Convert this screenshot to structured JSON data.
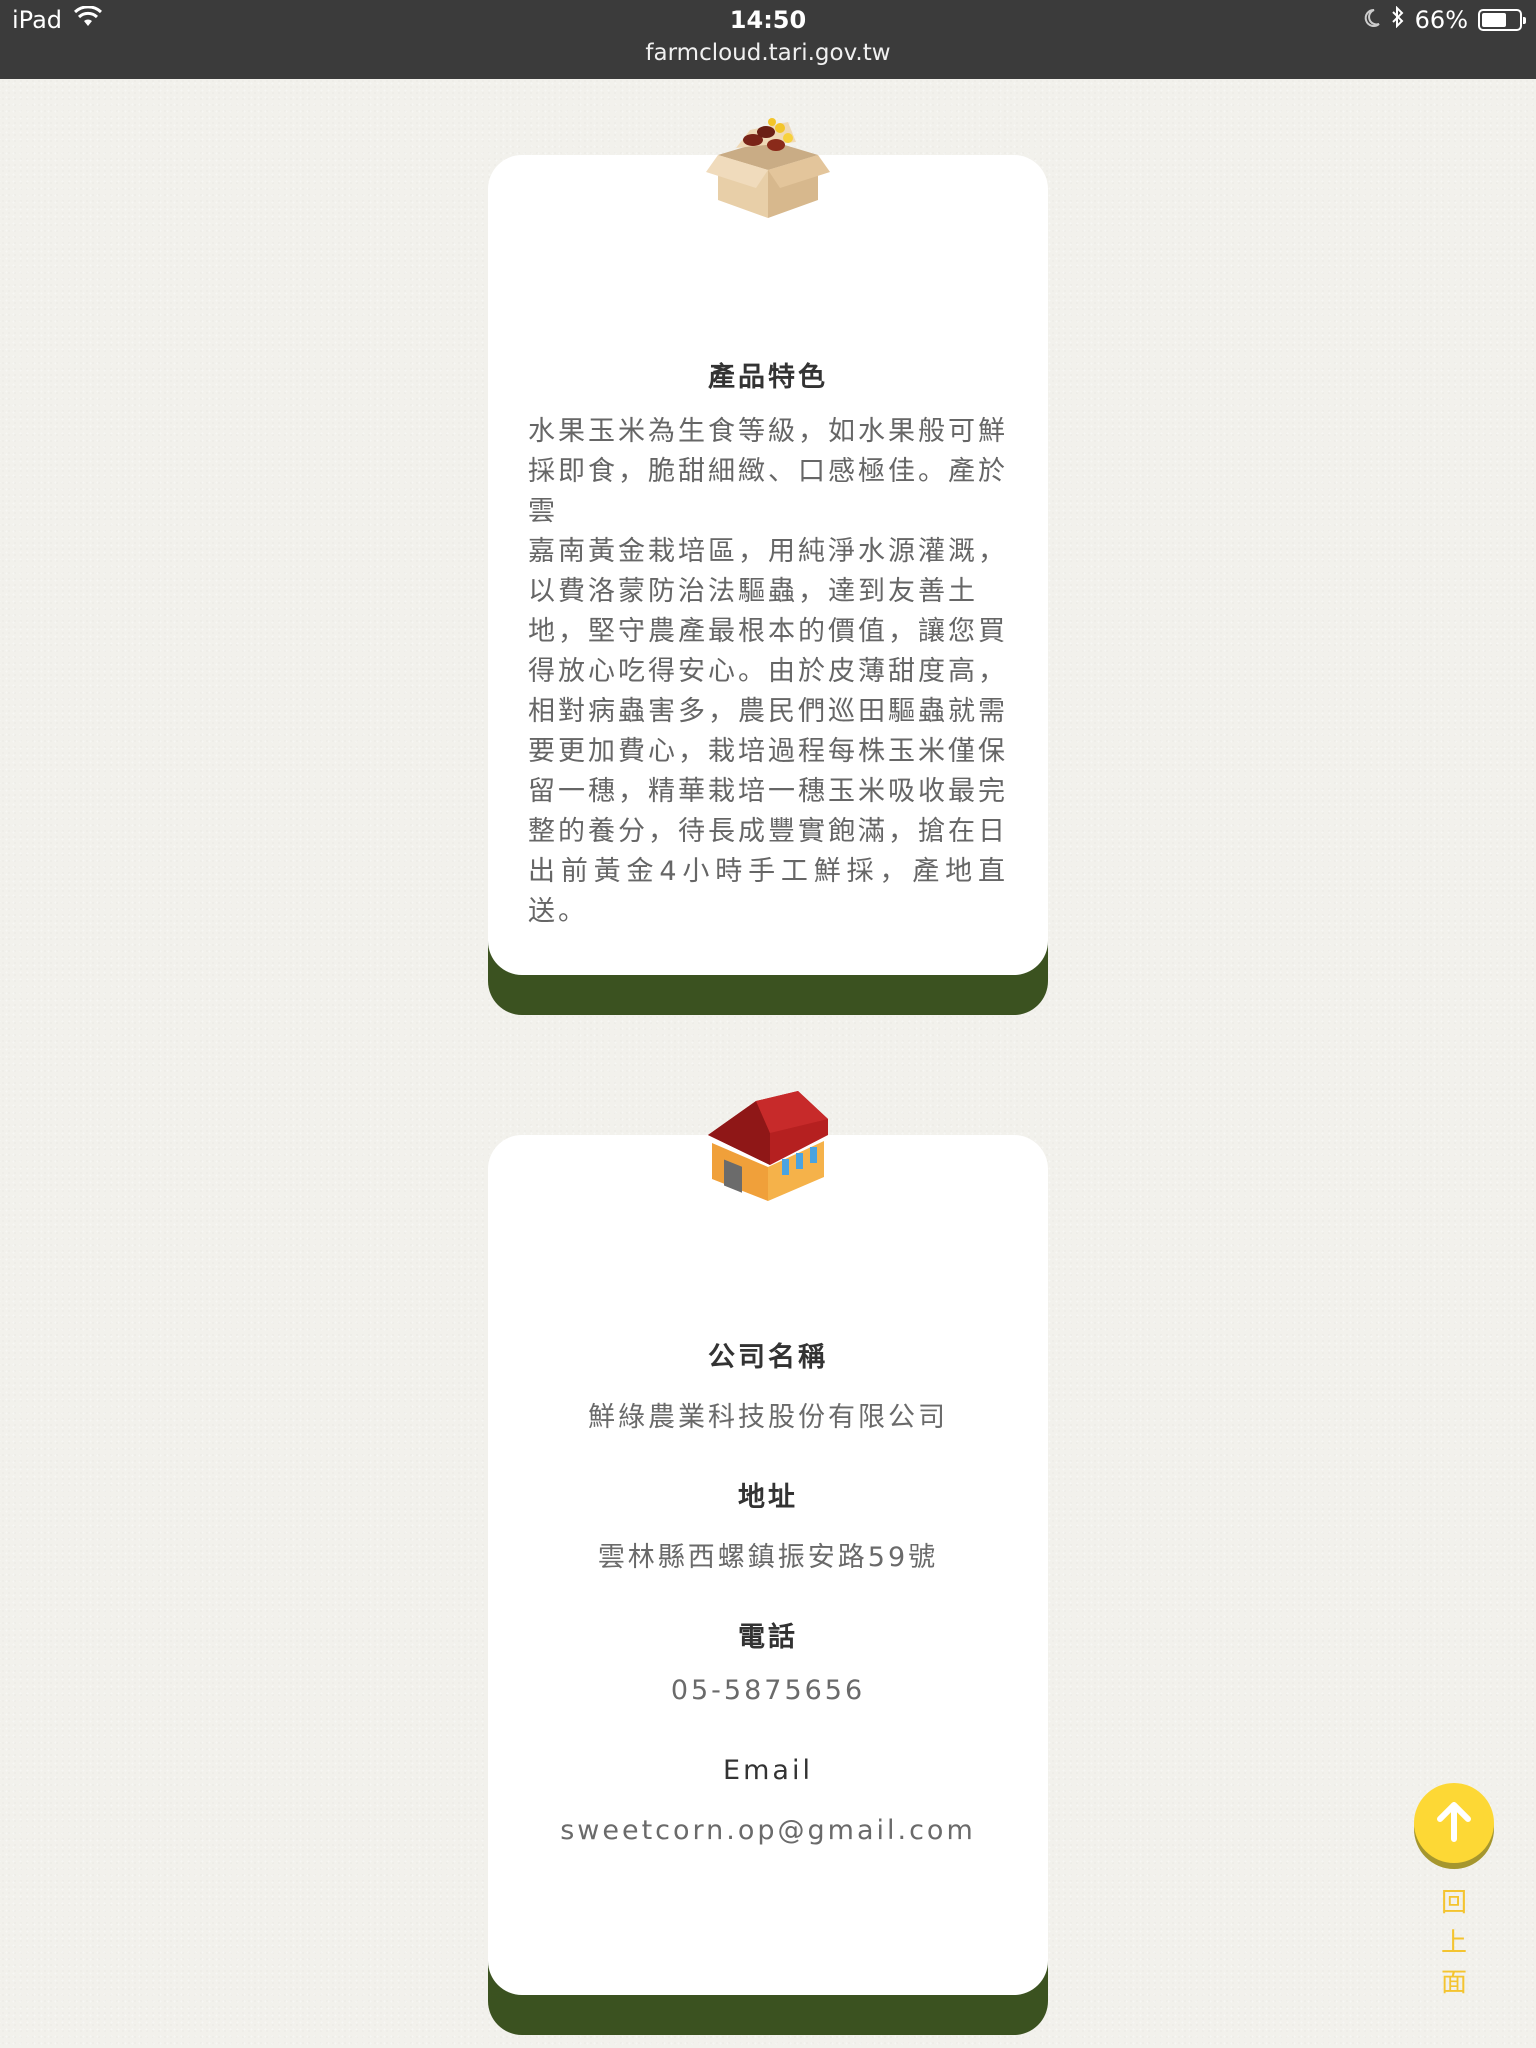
{
  "status_bar": {
    "device": "iPad",
    "time": "14:50",
    "battery": "66%",
    "battery_level": 0.66,
    "url": "farmcloud.tari.gov.tw"
  },
  "product_card": {
    "icon": "cardboard-box-icon",
    "heading": "產品特色",
    "lines": [
      "水果玉米為生食等級，如水果般可鮮",
      "採即食，脆甜細緻、口感極佳。產於雲",
      "嘉南黃金栽培區，用純淨水源灌溉，",
      "以費洛蒙防治法驅蟲，達到友善土",
      "地，堅守農產最根本的價值，讓您買",
      "得放心吃得安心。由於皮薄甜度高，",
      "相對病蟲害多，農民們巡田驅蟲就需",
      "要更加費心，栽培過程每株玉米僅保",
      "留一穗，精華栽培一穗玉米吸收最完",
      "整的養分，待長成豐實飽滿，搶在日",
      "出前黃金4小時手工鮮採，產地直送。"
    ]
  },
  "company_card": {
    "icon": "barn-icon",
    "name_label": "公司名稱",
    "name_value": "鮮綠農業科技股份有限公司",
    "address_label": "地址",
    "address_value": "雲林縣西螺鎮振安路59號",
    "phone_label": "電話",
    "phone_value": "05-5875656",
    "email_label": "Email",
    "email_value": "sweetcorn.op@gmail.com"
  },
  "back_to_top": {
    "icon": "arrow-up-icon",
    "label": "回上面"
  },
  "colors": {
    "card_shadow": "#3b5220",
    "accent_yellow": "#fdd835",
    "status_bar": "#3b3b3b"
  }
}
